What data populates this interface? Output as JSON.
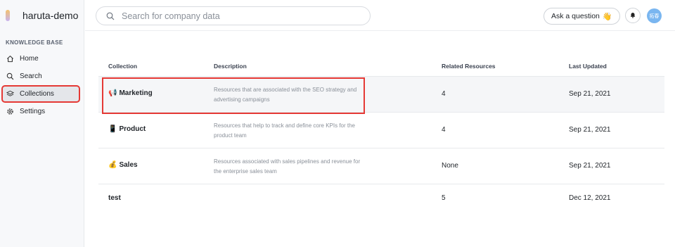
{
  "sidebar": {
    "brand": "haruta-demo",
    "section_heading": "KNOWLEDGE BASE",
    "items": [
      {
        "label": "Home",
        "icon": "home-icon"
      },
      {
        "label": "Search",
        "icon": "search-icon"
      },
      {
        "label": "Collections",
        "icon": "layers-icon",
        "active": true
      },
      {
        "label": "Settings",
        "icon": "gear-icon"
      }
    ]
  },
  "topbar": {
    "search_placeholder": "Search for company data",
    "ask_label": "Ask a question",
    "ask_emoji": "👋",
    "avatar_text": "拓春"
  },
  "table": {
    "columns": [
      "Collection",
      "Description",
      "Related Resources",
      "Last Updated"
    ],
    "rows": [
      {
        "emoji": "📢",
        "name": "Marketing",
        "description": "Resources that are associated with the SEO strategy and advertising campaigns",
        "related": "4",
        "updated": "Sep 21, 2021"
      },
      {
        "emoji": "📱",
        "name": "Product",
        "description": "Resources that help to track and define core KPIs for the product team",
        "related": "4",
        "updated": "Sep 21, 2021"
      },
      {
        "emoji": "💰",
        "name": "Sales",
        "description": "Resources associated with sales pipelines and revenue for the enterprise sales team",
        "related": "None",
        "updated": "Sep 21, 2021"
      },
      {
        "emoji": "",
        "name": "test",
        "description": "",
        "related": "5",
        "updated": "Dec 12, 2021"
      }
    ]
  },
  "colors": {
    "accent_highlight": "#e53935",
    "avatar_bg": "#7ab6f0",
    "sidebar_bg": "#f7f8fa"
  }
}
